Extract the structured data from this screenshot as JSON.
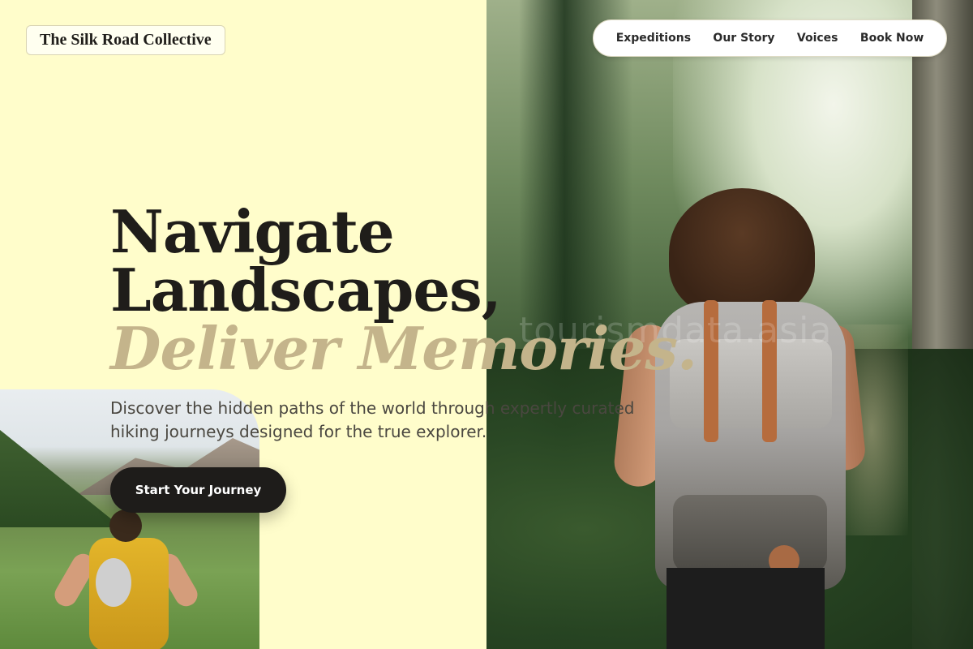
{
  "header": {
    "brand": "The Silk Road Collective",
    "nav": [
      "Expeditions",
      "Our Story",
      "Voices",
      "Book Now"
    ]
  },
  "hero": {
    "headline_line1": "Navigate",
    "headline_line2": "Landscapes,",
    "headline_accent": "Deliver Memories.",
    "subhead": "Discover the hidden paths of the world through expertly curated hiking journeys designed for the true explorer.",
    "cta": "Start Your Journey"
  },
  "watermark": "tourismdata.asia",
  "colors": {
    "background": "#fffdcb",
    "accent": "#c4b48b",
    "cta": "#1e1c1a"
  }
}
